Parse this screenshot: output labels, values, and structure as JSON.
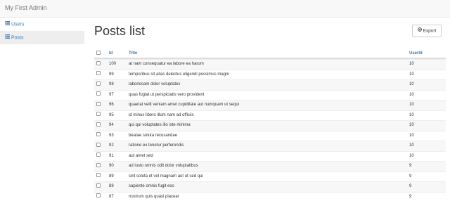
{
  "app": {
    "title": "My First Admin"
  },
  "sidebar": {
    "items": [
      {
        "label": "Users",
        "icon": "list-icon",
        "active": false
      },
      {
        "label": "Posts",
        "icon": "list-icon",
        "active": true
      }
    ]
  },
  "page": {
    "title": "Posts list",
    "export_label": "Export"
  },
  "table": {
    "headers": {
      "id": "Id",
      "title": "Title",
      "userId": "UserId"
    },
    "rows": [
      {
        "id": "100",
        "title": "at nam consequatur ea labore ea harum",
        "userId": "10"
      },
      {
        "id": "99",
        "title": "temporibus sit alias delectus eligendi possimus magni",
        "userId": "10"
      },
      {
        "id": "98",
        "title": "laboriosam dolor voluptates",
        "userId": "10"
      },
      {
        "id": "97",
        "title": "quas fugiat ut perspiciatis vero provident",
        "userId": "10"
      },
      {
        "id": "96",
        "title": "quaerat velit veniam amet cupiditate aut numquam ut sequi",
        "userId": "10"
      },
      {
        "id": "95",
        "title": "id minus libero illum nam ad officiis",
        "userId": "10"
      },
      {
        "id": "94",
        "title": "qui qui voluptates illo iste minima",
        "userId": "10"
      },
      {
        "id": "93",
        "title": "beatae soluta recusandae",
        "userId": "10"
      },
      {
        "id": "92",
        "title": "ratione ex tenetur perferendis",
        "userId": "10"
      },
      {
        "id": "91",
        "title": "aut amet sed",
        "userId": "10"
      },
      {
        "id": "90",
        "title": "ad iusto omnis odit dolor voluptatibus",
        "userId": "9"
      },
      {
        "id": "89",
        "title": "sint soluta et vel magnam aut ut sed qui",
        "userId": "9"
      },
      {
        "id": "88",
        "title": "sapiente omnis fugit eos",
        "userId": "9"
      },
      {
        "id": "87",
        "title": "nostrum quis quasi placeat",
        "userId": "9"
      }
    ]
  },
  "colors": {
    "link": "#337ab7",
    "navbar_bg": "#f8f8f8",
    "active_bg": "#eeeeee",
    "stripe": "#f7f7f7"
  }
}
